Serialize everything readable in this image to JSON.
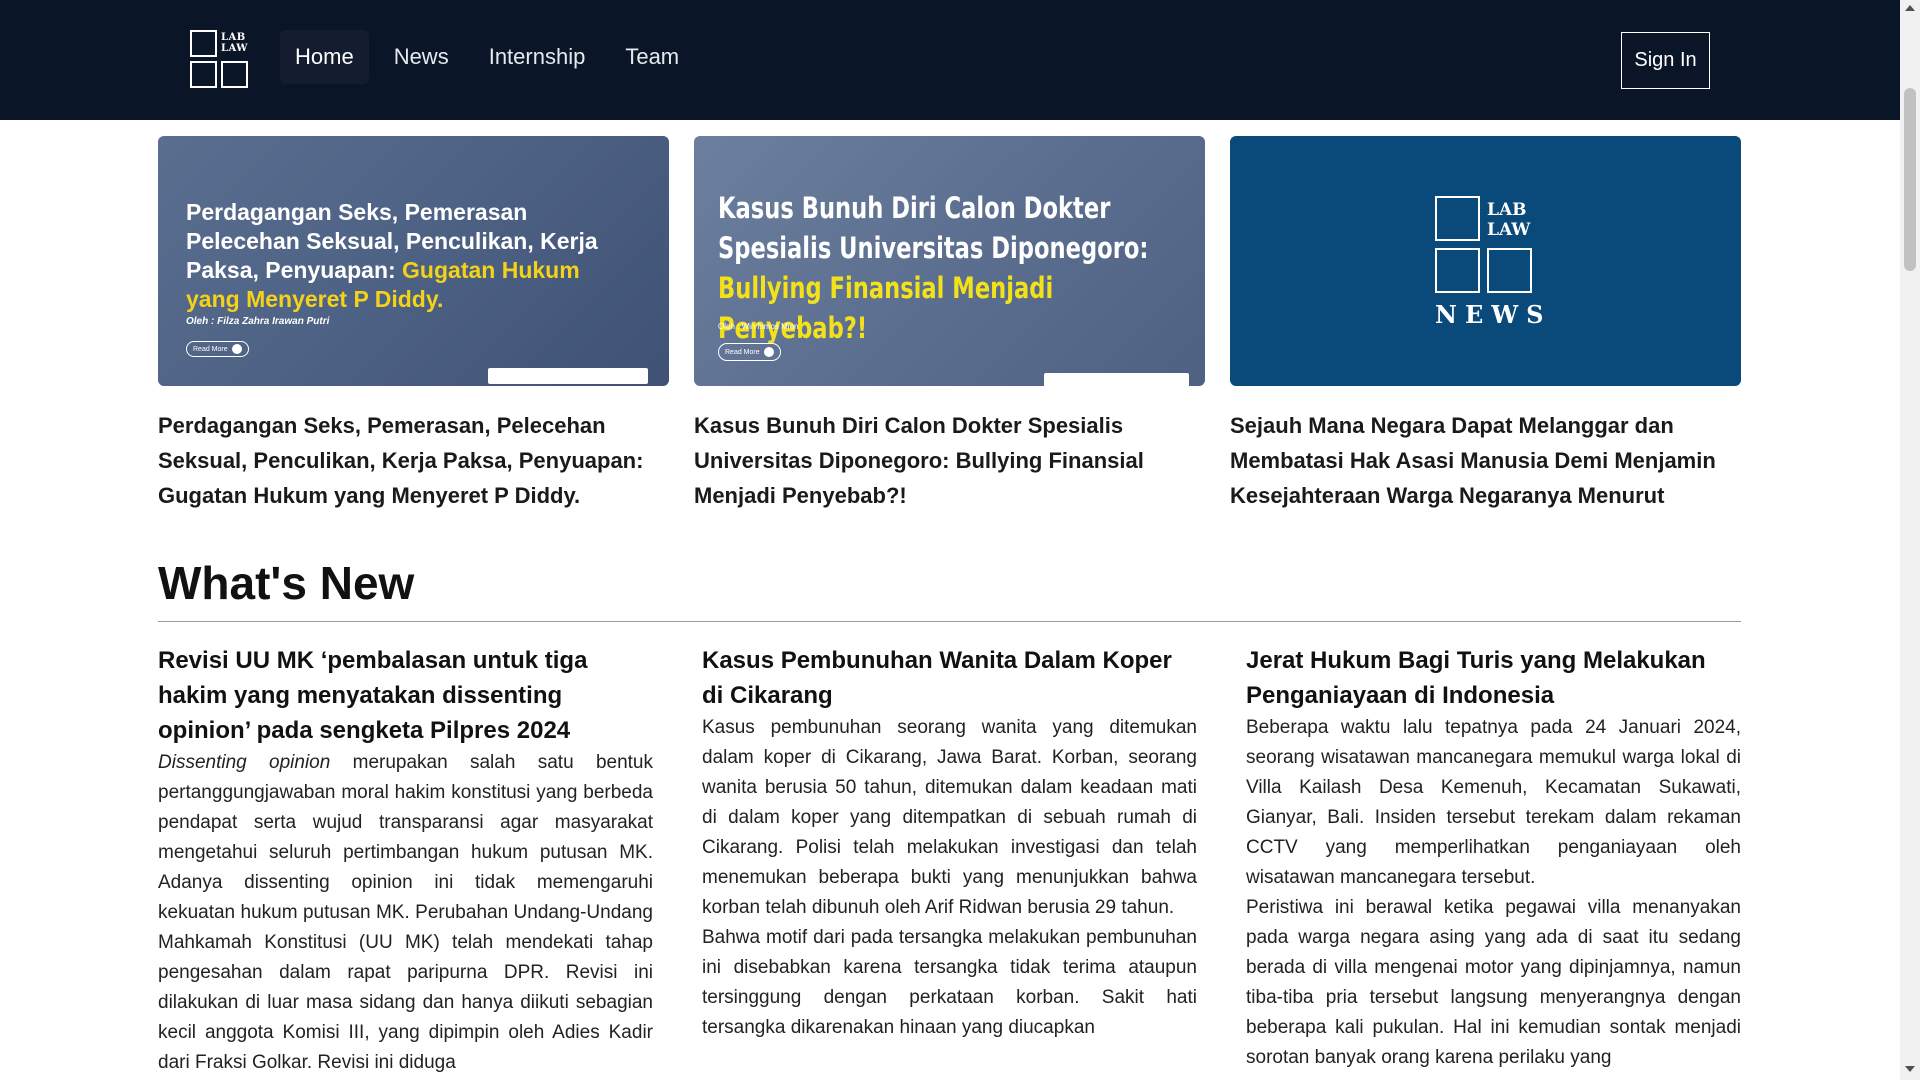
{
  "header": {
    "logo_text_line1": "LAB",
    "logo_text_line2": "LAW",
    "nav": [
      {
        "label": "Home",
        "active": true
      },
      {
        "label": "News",
        "active": false
      },
      {
        "label": "Internship",
        "active": false
      },
      {
        "label": "Team",
        "active": false
      }
    ],
    "signin_label": "Sign In"
  },
  "featured": [
    {
      "image": {
        "headline_plain": "Perdagangan Seks, Pemerasan Pelecehan Seksual, Penculikan, Kerja Paksa, Penyuapan: ",
        "headline_highlight": "Gugatan Hukum yang Menyeret P Diddy.",
        "author": "Oleh : Filza Zahra Irawan Putri",
        "read_more": "Read More"
      },
      "title": "Perdagangan Seks, Pemerasan, Pelecehan Seksual, Penculikan, Kerja Paksa, Penyuapan: Gugatan Hukum yang Menyeret P Diddy."
    },
    {
      "image": {
        "headline_plain": "Kasus Bunuh Diri Calon Dokter Spesialis Universitas Diponegoro: ",
        "headline_highlight": "Bullying Finansial Menjadi Penyebab?!",
        "author": "Oleh : Win Ismos Mion",
        "read_more": "Read More"
      },
      "title": "Kasus Bunuh Diri Calon Dokter Spesialis Universitas Diponegoro: Bullying Finansial Menjadi Penyebab?!"
    },
    {
      "image": {
        "logo_line1": "LAB",
        "logo_line2": "LAW",
        "logo_word": "NEWS"
      },
      "title": "Sejauh Mana Negara Dapat Melanggar dan Membatasi Hak Asasi Manusia Demi Menjamin Kesejahteraan Warga Negaranya Menurut Sudut..."
    }
  ],
  "whats_new": {
    "heading": "What's New",
    "articles": [
      {
        "title": "Revisi UU MK ‘pembalasan untuk tiga hakim yang menyatakan dissenting opinion’ pada sengketa Pilpres 2024",
        "body_italic": "Dissenting opinion",
        "body": " merupakan salah satu bentuk pertanggungjawaban moral hakim konstitusi yang berbeda pendapat serta wujud transparansi agar masyarakat mengetahui seluruh pertimbangan hukum putusan MK. Adanya dissenting opinion ini tidak memengaruhi kekuatan hukum putusan MK. Perubahan Undang-Undang Mahkamah Konstitusi (UU MK) telah mendekati tahap pengesahan dalam rapat paripurna DPR. Revisi ini dilakukan di luar masa sidang dan hanya diikuti sebagian kecil anggota Komisi III, yang dipimpin oleh Adies Kadir dari Fraksi Golkar. Revisi ini diduga"
      },
      {
        "title": "Kasus Pembunuhan Wanita Dalam Koper di Cikarang",
        "paragraphs": [
          "Kasus pembunuhan seorang wanita yang ditemukan dalam koper di Cikarang, Jawa Barat. Korban, seorang wanita berusia 50 tahun, ditemukan dalam keadaan mati di dalam koper yang ditempatkan di sebuah rumah di Cikarang. Polisi telah melakukan investigasi dan telah menemukan beberapa bukti yang menunjukkan bahwa korban telah dibunuh oleh Arif Ridwan berusia 29 tahun.",
          "Bahwa motif dari pada tersangka melakukan pembunuhan ini disebabkan karena tersangka tidak terima ataupun tersinggung dengan perkataan korban. Sakit hati tersangka dikarenakan hinaan yang diucapkan"
        ]
      },
      {
        "title": "Jerat Hukum Bagi Turis yang Melakukan Penganiayaan di Indonesia",
        "paragraphs": [
          "Beberapa waktu lalu tepatnya pada 24 Januari 2024, seorang wisatawan mancanegara memukul warga lokal di Villa Kailash Desa Kemenuh, Kecamatan Sukawati, Gianyar, Bali. Insiden tersebut terekam dalam rekaman CCTV yang memperlihatkan penganiayaan oleh wisatawan mancanegara tersebut.",
          "Peristiwa ini berawal ketika pegawai villa menanyakan pada warga negara asing yang ada di saat itu sedang berada di villa mengenai motor yang dipinjamnya, namun tiba-tiba pria tersebut langsung menyerangnya dengan beberapa kali pukulan. Hal ini kemudian sontak menjadi sorotan banyak orang karena perilaku yang"
        ]
      }
    ]
  }
}
